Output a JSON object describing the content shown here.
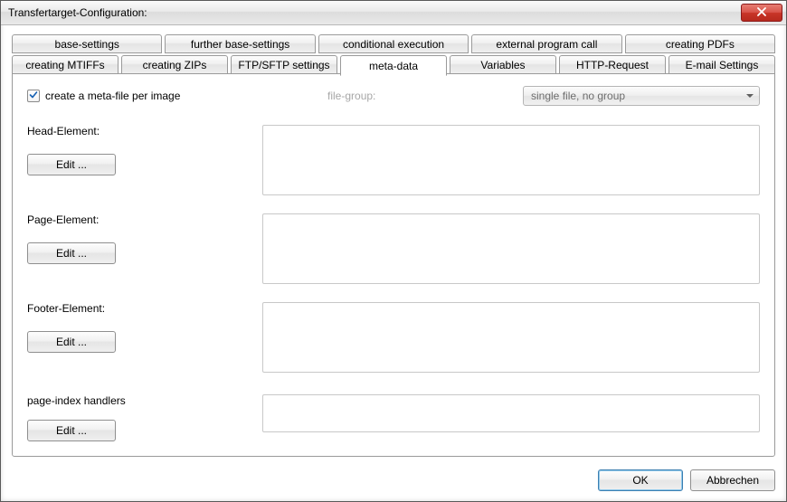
{
  "window": {
    "title": "Transfertarget-Configuration:"
  },
  "tabs": {
    "row1": [
      "base-settings",
      "further base-settings",
      "conditional execution",
      "external program call",
      "creating PDFs"
    ],
    "row2": [
      "creating MTIFFs",
      "creating ZIPs",
      "FTP/SFTP settings",
      "meta-data",
      "Variables",
      "HTTP-Request",
      "E-mail Settings"
    ],
    "active": "meta-data"
  },
  "meta": {
    "checkbox_label": "create a meta-file per image",
    "checkbox_checked": true,
    "file_group_label": "file-group:",
    "combo_value": "single file, no group"
  },
  "sections": {
    "head": {
      "label": "Head-Element:",
      "edit": "Edit ...",
      "value": ""
    },
    "page": {
      "label": "Page-Element:",
      "edit": "Edit ...",
      "value": ""
    },
    "footer": {
      "label": "Footer-Element:",
      "edit": "Edit ...",
      "value": ""
    },
    "index": {
      "label": "page-index handlers",
      "edit": "Edit ...",
      "value": ""
    }
  },
  "buttons": {
    "ok": "OK",
    "cancel": "Abbrechen"
  }
}
